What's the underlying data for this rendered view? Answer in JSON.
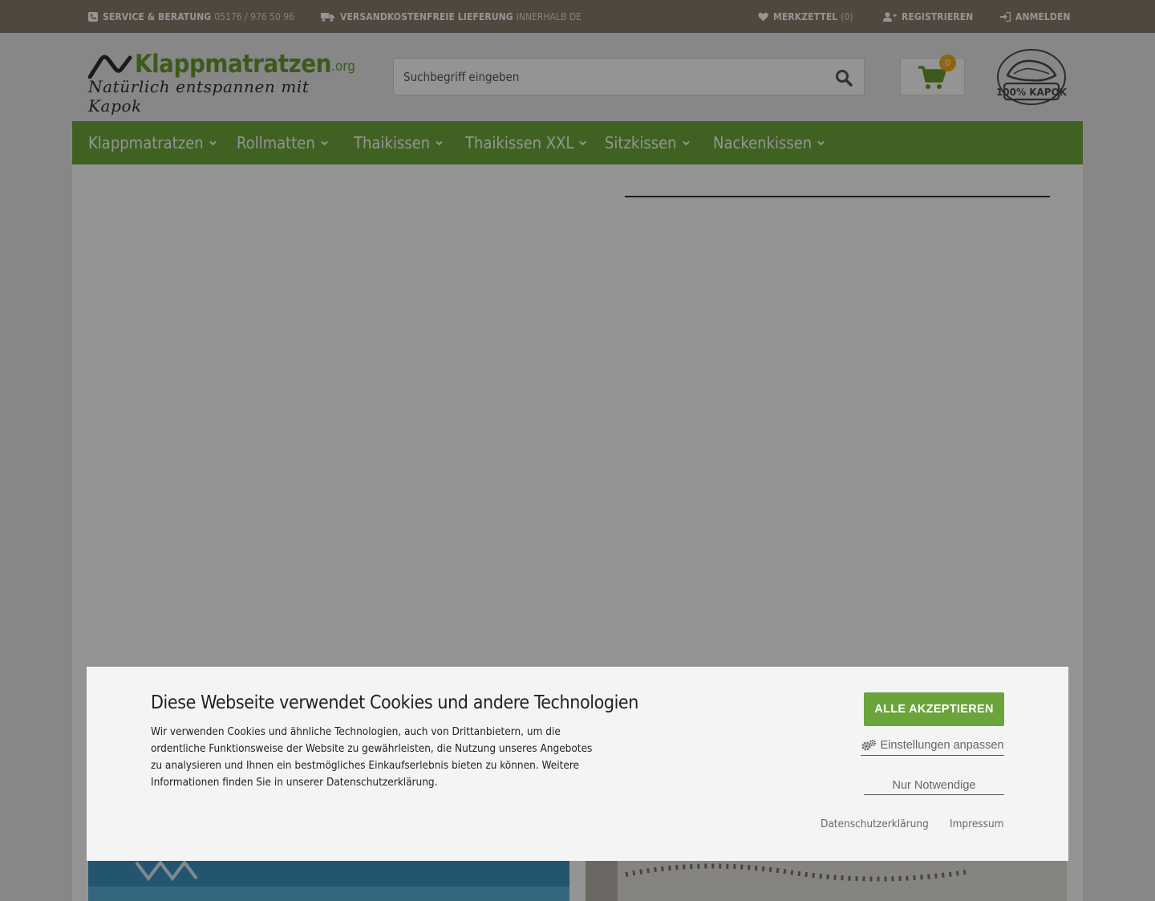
{
  "topbar": {
    "service_label": "SERVICE & BERATUNG",
    "service_phone": "05176 / 976 50 96",
    "shipping_label": "VERSANDKOSTENFREIE LIEFERUNG",
    "shipping_detail": "INNERHALB DE",
    "wishlist_label": "MERKZETTEL",
    "wishlist_count": "(0)",
    "register_label": "REGISTRIEREN",
    "login_label": "ANMELDEN"
  },
  "header": {
    "logo_name": "Klappmatratzen",
    "logo_tld": ".org",
    "logo_tagline": "Natürlich entspannen mit Kapok",
    "search_placeholder": "Suchbegriff eingeben",
    "cart_count": "0",
    "kapok_badge": "100% KAPOK"
  },
  "nav": {
    "items": [
      {
        "label": "Klappmatratzen"
      },
      {
        "label": "Rollmatten"
      },
      {
        "label": "Thaikissen"
      },
      {
        "label": "Thaikissen XXL"
      },
      {
        "label": "Sitzkissen"
      },
      {
        "label": "Nackenkissen"
      }
    ]
  },
  "cookie": {
    "title": "Diese Webseite verwendet Cookies und andere Technologien",
    "body": "Wir verwenden Cookies und ähnliche Technologien, auch von Drittanbietern, um die ordentliche Funktionsweise der Website zu gewährleisten, die Nutzung unseres Angebotes zu analysieren und Ihnen ein bestmögliches Einkaufserlebnis bieten zu können. Weitere Informationen finden Sie in unserer Datenschutzerklärung.",
    "accept_all": "ALLE AKZEPTIEREN",
    "customize": "Einstellungen anpassen",
    "necessary_only": "Nur Notwendige",
    "privacy_link": "Datenschutzerklärung",
    "imprint_link": "Impressum"
  },
  "colors": {
    "topbar_bg": "#897c6c",
    "brand_green": "#6fa83b",
    "badge_orange": "#f3ae1c"
  }
}
